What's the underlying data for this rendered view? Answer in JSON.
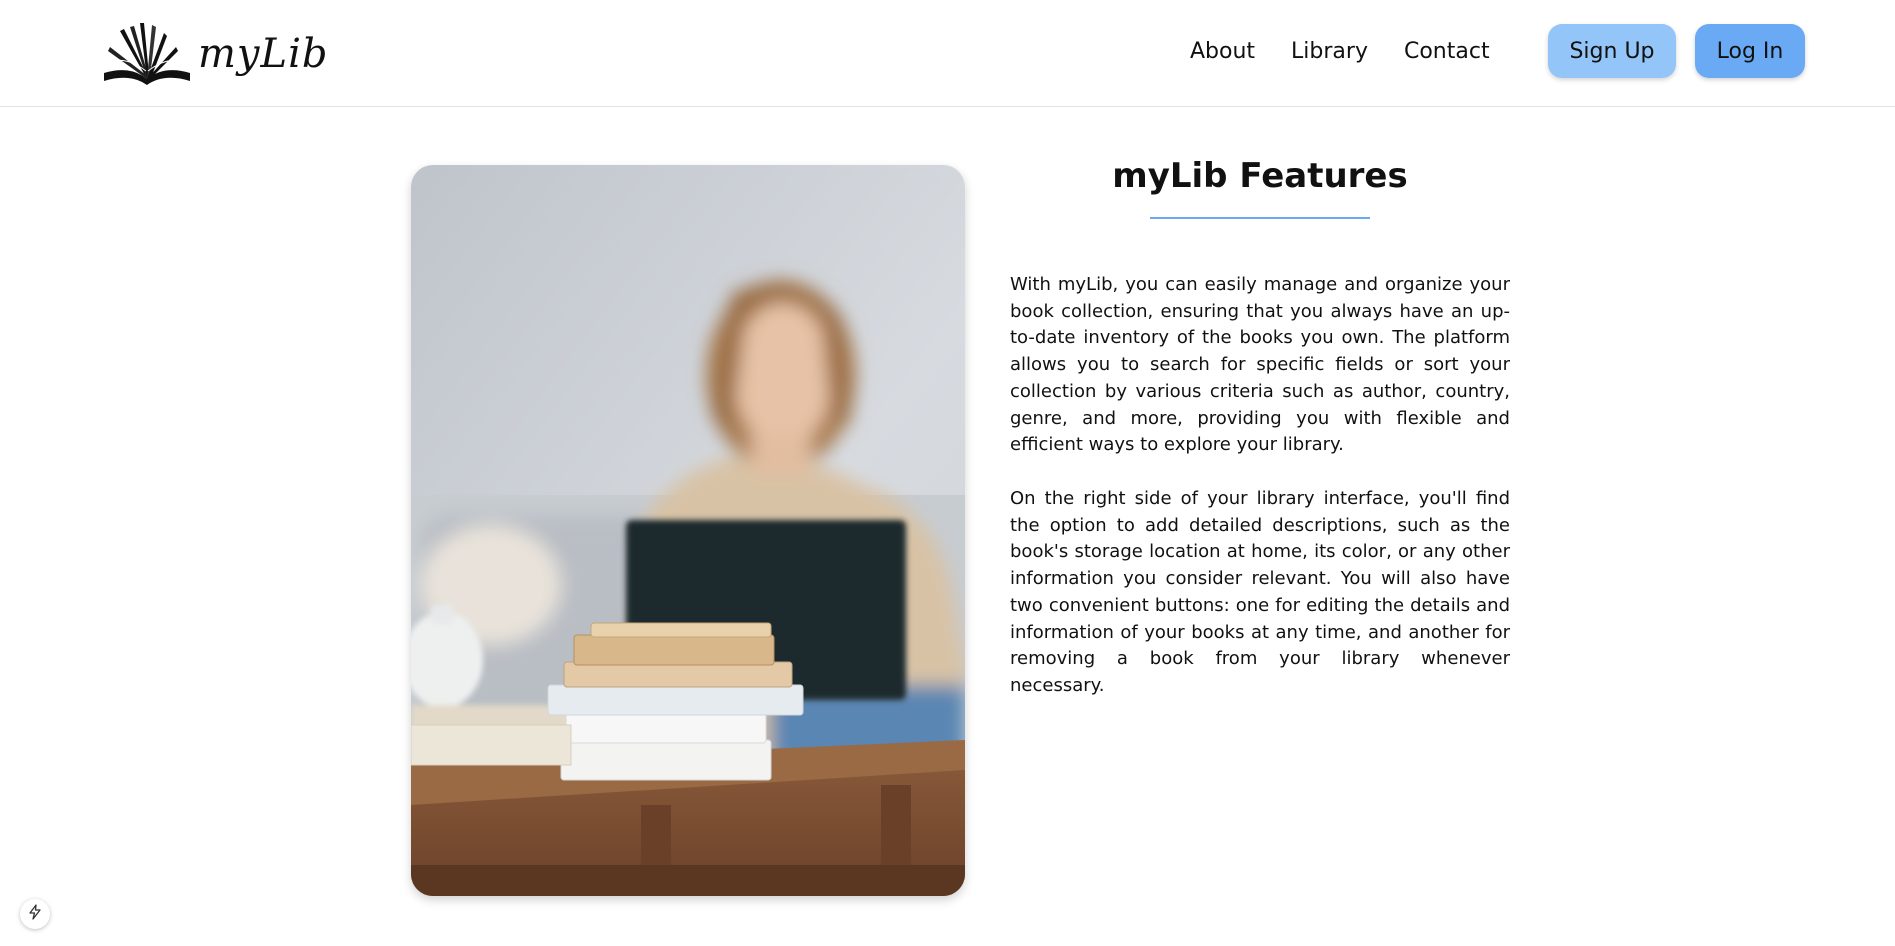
{
  "header": {
    "logo_text": "myLib",
    "logo_icon": "open-book-icon",
    "nav": {
      "about": "About",
      "library": "Library",
      "contact": "Contact"
    },
    "signup_label": "Sign Up",
    "login_label": "Log In"
  },
  "colors": {
    "signup_bg": "#93c5f8",
    "login_bg": "#6aaaf4",
    "accent_rule": "#6aaaf4"
  },
  "main": {
    "title": "myLib Features",
    "paragraphs": [
      "With myLib, you can easily manage and organize your book collection, ensuring that you always have an up-to-date inventory of the books you own. The platform allows you to search for specific fields or sort your collection by various criteria such as author, country, genre, and more, providing you with flexible and efficient ways to explore your library.",
      "On the right side of your library interface, you'll find the option to add detailed descriptions, such as the book's storage location at home, its color, or any other information you consider relevant. You will also have two convenient buttons: one for editing the details and information of your books at any time, and another for removing a book from your library whenever necessary."
    ]
  },
  "corner_icon": "lightning-icon"
}
